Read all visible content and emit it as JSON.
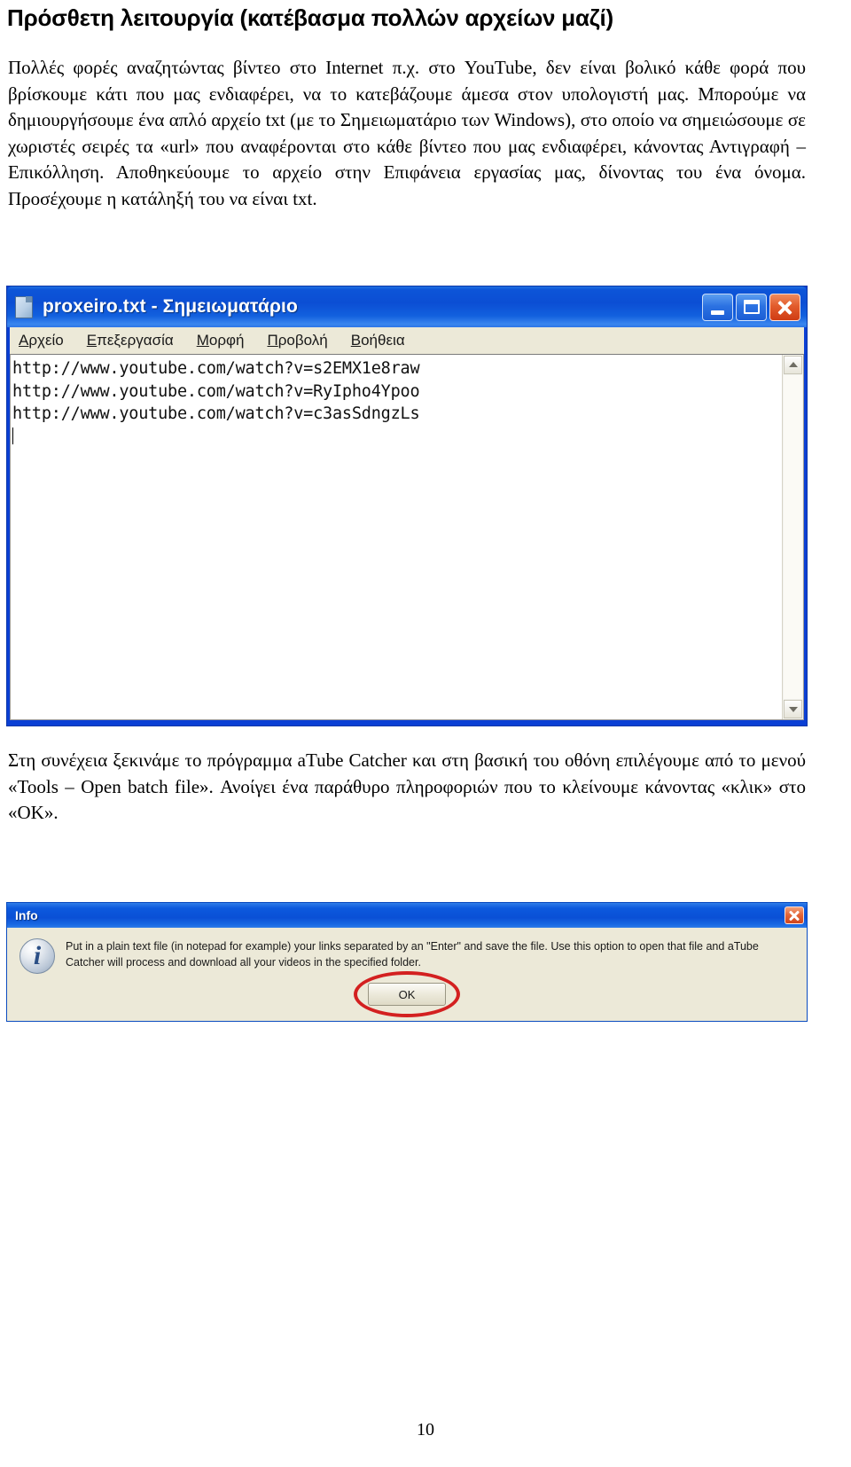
{
  "document": {
    "title": "Πρόσθετη λειτουργία (κατέβασμα πολλών αρχείων μαζί)",
    "paragraph_1": "Πολλές φορές αναζητώντας βίντεο στο Internet π.χ. στο YouTube, δεν είναι βολικό κάθε φορά που βρίσκουμε κάτι που μας ενδιαφέρει, να το κατεβάζουμε άμεσα στον υπολογιστή μας. Μπορούμε να δημιουργήσουμε ένα απλό αρχείο txt (με το Σημειωματάριο των Windows), στο οποίο να σημειώσουμε σε χωριστές σειρές τα «url» που αναφέρονται στο κάθε βίντεο που μας ενδιαφέρει, κάνοντας Αντιγραφή – Επικόλληση. Αποθηκεύουμε το αρχείο στην Επιφάνεια εργασίας μας, δίνοντας του ένα όνομα. Προσέχουμε η κατάληξή του να είναι txt.",
    "paragraph_2": "Στη συνέχεια ξεκινάμε το πρόγραμμα aTube Catcher και στη βασική του οθόνη επιλέγουμε από το μενού «Tools – Open batch file». Ανοίγει ένα παράθυρο πληροφοριών που το κλείνουμε κάνοντας «κλικ» στο «OK».",
    "page_number": "10"
  },
  "notepad": {
    "title": "proxeiro.txt - Σημειωματάριο",
    "icon": "notepad-document-icon",
    "menu": [
      {
        "prefix": "",
        "mnemonic": "Α",
        "rest": "ρχείο"
      },
      {
        "prefix": "",
        "mnemonic": "Ε",
        "rest": "πεξεργασία"
      },
      {
        "prefix": "",
        "mnemonic": "Μ",
        "rest": "ορφή"
      },
      {
        "prefix": "",
        "mnemonic": "Π",
        "rest": "ροβολή"
      },
      {
        "prefix": "",
        "mnemonic": "Β",
        "rest": "οήθεια"
      }
    ],
    "content_lines": [
      "http://www.youtube.com/watch?v=s2EMX1e8raw",
      "http://www.youtube.com/watch?v=RyIpho4Ypoo",
      "http://www.youtube.com/watch?v=c3asSdngzLs"
    ],
    "window_buttons": {
      "minimize": "minimize-icon",
      "maximize": "maximize-icon",
      "close": "close-icon"
    },
    "scrollbar": {
      "up_arrow": "scroll-up-arrow-icon",
      "down_arrow": "scroll-down-arrow-icon"
    }
  },
  "info_dialog": {
    "title": "Info",
    "icon_glyph": "i",
    "message": "Put in a plain text file (in notepad for example) your links separated by an \"Enter\" and save the file. Use this option to open that file and aTube Catcher will process and download all your videos in the specified folder.",
    "ok_label": "OK",
    "close": "close-icon",
    "highlight_color": "#d32020"
  }
}
